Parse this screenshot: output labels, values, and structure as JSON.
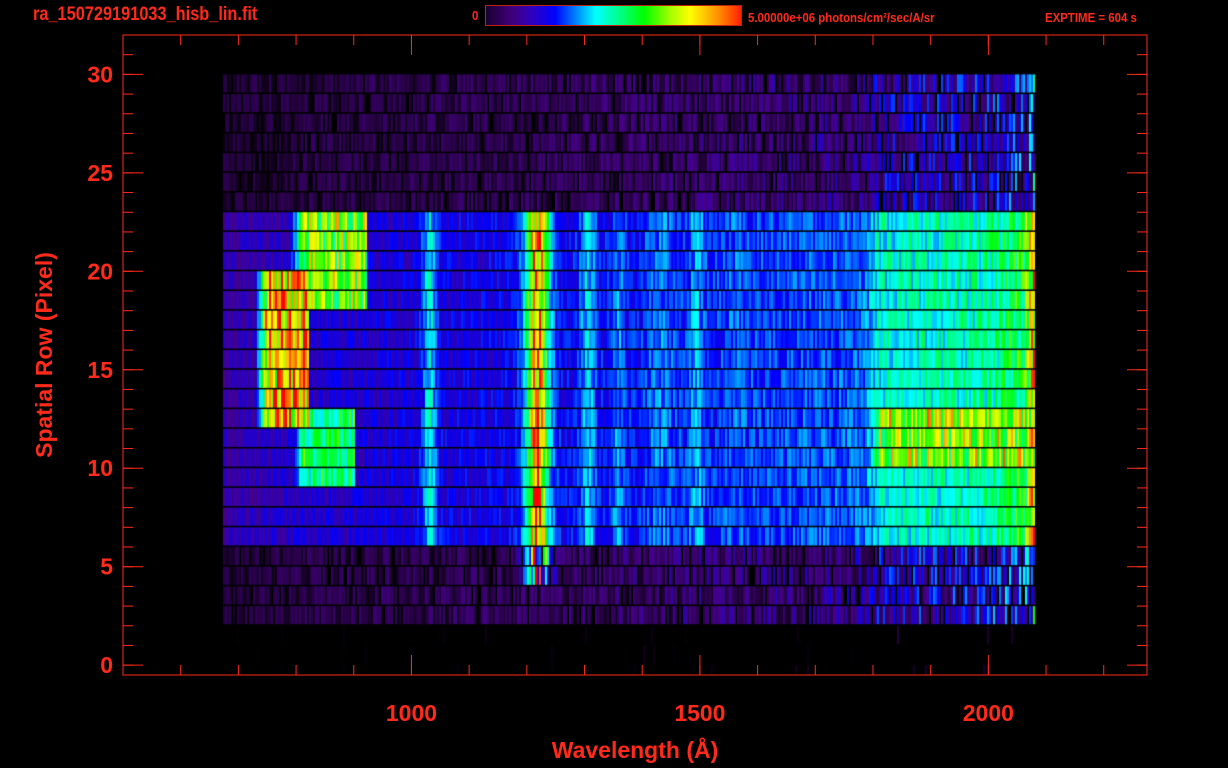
{
  "header": {
    "title": "ra_150729191033_hisb_lin.fit",
    "colorbar_min_label": "0",
    "colorbar_max_label": "5.00000e+06 photons/cm²/sec/A/sr",
    "exptime": "EXPTIME = 604 s"
  },
  "chart_data": {
    "type": "heatmap",
    "xlabel": "Wavelength (Å)",
    "ylabel": "Spatial Row (Pixel)",
    "xlim": [
      500,
      2275
    ],
    "ylim": [
      -0.5,
      32
    ],
    "xticks": [
      1000,
      1500,
      2000
    ],
    "xminor_step": 100,
    "yticks": [
      0,
      5,
      10,
      15,
      20,
      25,
      30
    ],
    "yminor_step": 1,
    "grid": false,
    "colormap": "rainbow",
    "colorbar": {
      "min": 0,
      "max": 5000000,
      "units": "photons/cm²/sec/A/sr"
    },
    "colors": {
      "axes": "#ff2a1a",
      "background": "#000000"
    },
    "wavelength_range": [
      670,
      2080
    ],
    "row_profile": [
      {
        "rows": [
          0,
          2
        ],
        "scale": 0.08
      },
      {
        "rows": [
          3,
          6
        ],
        "scale": 0.55
      },
      {
        "rows": [
          7,
          23
        ],
        "scale": 1.0
      },
      {
        "rows": [
          24,
          30
        ],
        "scale": 0.5
      }
    ],
    "continuum": [
      [
        670,
        900000.0
      ],
      [
        800,
        1100000.0
      ],
      [
        1000,
        1200000.0
      ],
      [
        1200,
        1300000.0
      ],
      [
        1500,
        1500000.0
      ],
      [
        1780,
        1700000.0
      ],
      [
        1810,
        2400000.0
      ],
      [
        2000,
        2600000.0
      ],
      [
        2060,
        3100000.0
      ],
      [
        2080,
        4500000.0
      ]
    ],
    "lines": [
      {
        "wavelength": 1030,
        "peak": 2300000.0,
        "width": 12,
        "rows": [
          7,
          23
        ]
      },
      {
        "wavelength": 1216,
        "peak": 4600000.0,
        "width": 20,
        "rows": [
          5,
          23
        ]
      },
      {
        "wavelength": 1304,
        "peak": 2200000.0,
        "width": 12,
        "rows": [
          7,
          23
        ]
      },
      {
        "wavelength": 1356,
        "peak": 1900000.0,
        "width": 10,
        "rows": [
          7,
          23
        ]
      },
      {
        "wavelength": 1430,
        "peak": 1800000.0,
        "width": 25,
        "rows": [
          7,
          23
        ]
      },
      {
        "wavelength": 1493,
        "peak": 2000000.0,
        "width": 12,
        "rows": [
          7,
          23
        ]
      },
      {
        "wavelength": 1560,
        "peak": 1700000.0,
        "width": 20,
        "rows": [
          7,
          23
        ]
      }
    ],
    "emission_regions": [
      {
        "wavelength": [
          740,
          820
        ],
        "rows": [
          13,
          20
        ],
        "peak": 4800000.0
      },
      {
        "wavelength": [
          800,
          920
        ],
        "rows": [
          19,
          23
        ],
        "peak": 3800000.0
      },
      {
        "wavelength": [
          800,
          900
        ],
        "rows": [
          10,
          13
        ],
        "peak": 3000000.0
      },
      {
        "wavelength": [
          1800,
          2075
        ],
        "rows": [
          11,
          13
        ],
        "peak": 4000000.0
      }
    ]
  }
}
